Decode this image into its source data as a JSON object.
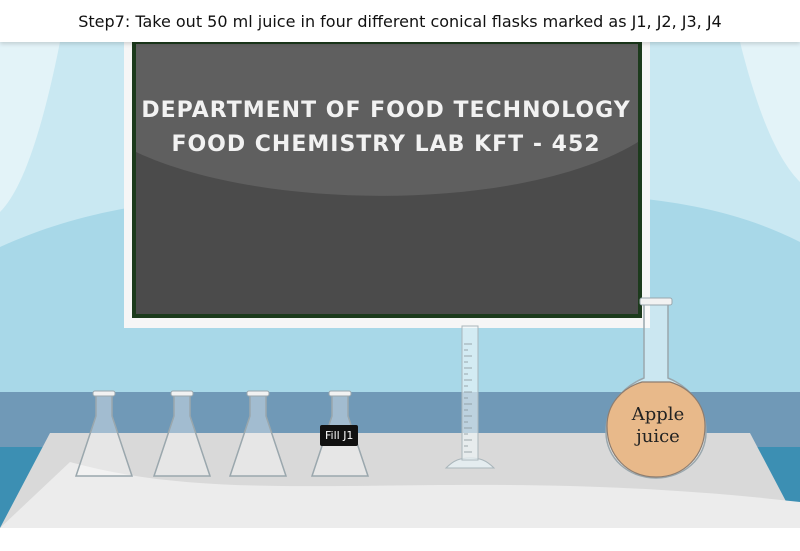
{
  "instruction": {
    "step_text": "Step7: Take out 50 ml juice in four different conical flasks marked as J1, J2, J3, J4"
  },
  "blackboard": {
    "line1": "DEPARTMENT OF FOOD TECHNOLOGY",
    "line2": "FOOD CHEMISTRY LAB KFT - 452"
  },
  "flasks": [
    {
      "id": "J1",
      "state": "empty"
    },
    {
      "id": "J2",
      "state": "empty"
    },
    {
      "id": "J3",
      "state": "empty"
    },
    {
      "id": "J4",
      "state": "empty"
    }
  ],
  "tooltip": {
    "label": "Fill J1"
  },
  "round_flask": {
    "line1": "Apple",
    "line2": "juice"
  },
  "colors": {
    "wall": "#a9d9e8",
    "spotlight": "#cfeaf3",
    "board_frame": "#f5f5f5",
    "board": "#4a4a4a",
    "counter_band": "#6f9cba",
    "table": "#d6d6d6",
    "juice": "#e8b98a"
  }
}
